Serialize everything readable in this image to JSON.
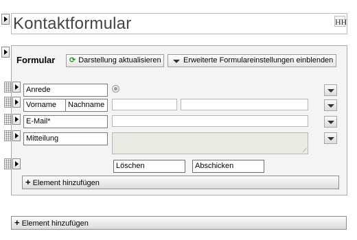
{
  "page": {
    "title": "Kontaktformular",
    "title_icon_glyph": "HH"
  },
  "form": {
    "label": "Formular",
    "refresh_button": "Darstellung aktualisieren",
    "advanced_button": "Erweiterte Formulareinstellungen einblenden",
    "fields": {
      "anrede": "Anrede",
      "vorname": "Vorname",
      "nachname": "Nachname",
      "email": "E-Mail*",
      "mitteilung": "Mitteilung"
    },
    "reset_button": "Löschen",
    "submit_button": "Abschicken",
    "add_element": "Element hinzufügen"
  },
  "page_add_element": "Element hinzufügen",
  "icons": [
    "expand-arrow-icon",
    "drag-grip-icon",
    "refresh-icon",
    "chevron-down-icon",
    "plus-icon",
    "radio-icon",
    "heading-icon"
  ],
  "colors": {
    "panel_bg": "#f4f4f4",
    "refresh_icon": "#2e9a2e",
    "border": "#a9a9a9"
  }
}
